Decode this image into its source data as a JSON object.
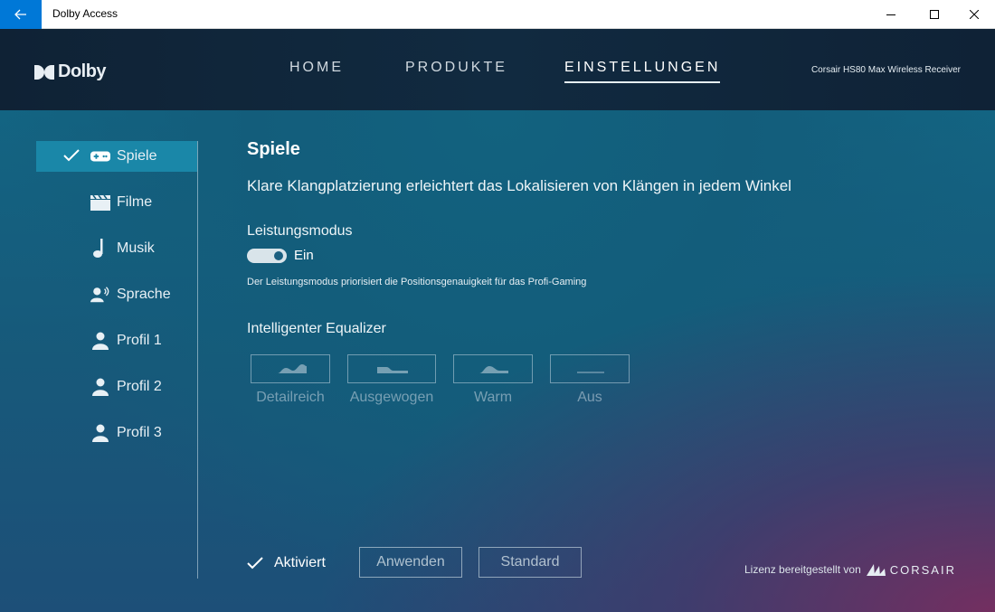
{
  "window": {
    "title": "Dolby Access"
  },
  "header": {
    "logo_text": "Dolby",
    "nav": [
      {
        "label": "HOME"
      },
      {
        "label": "PRODUKTE"
      },
      {
        "label": "EINSTELLUNGEN"
      }
    ],
    "device": "Corsair HS80 Max Wireless Receiver"
  },
  "sidebar": {
    "items": [
      {
        "label": "Spiele",
        "icon": "gamepad-icon",
        "active": true
      },
      {
        "label": "Filme",
        "icon": "clapperboard-icon"
      },
      {
        "label": "Musik",
        "icon": "music-note-icon"
      },
      {
        "label": "Sprache",
        "icon": "voice-icon"
      },
      {
        "label": "Profil 1",
        "icon": "user-icon"
      },
      {
        "label": "Profil 2",
        "icon": "user-icon"
      },
      {
        "label": "Profil 3",
        "icon": "user-icon"
      }
    ]
  },
  "content": {
    "title": "Spiele",
    "description": "Klare Klangplatzierung erleichtert das Lokalisieren von Klängen in jedem Winkel",
    "performance": {
      "label": "Leistungsmodus",
      "state_label": "Ein",
      "on": true,
      "note": "Der Leistungsmodus priorisiert die Positionsgenauigkeit für das Profi-Gaming"
    },
    "equalizer": {
      "title": "Intelligenter Equalizer",
      "presets": [
        {
          "label": "Detailreich"
        },
        {
          "label": "Ausgewogen"
        },
        {
          "label": "Warm"
        },
        {
          "label": "Aus"
        }
      ]
    }
  },
  "footer": {
    "activated_label": "Aktiviert",
    "apply_label": "Anwenden",
    "standard_label": "Standard",
    "license_label": "Lizenz bereitgestellt von",
    "license_brand": "CORSAIR"
  }
}
